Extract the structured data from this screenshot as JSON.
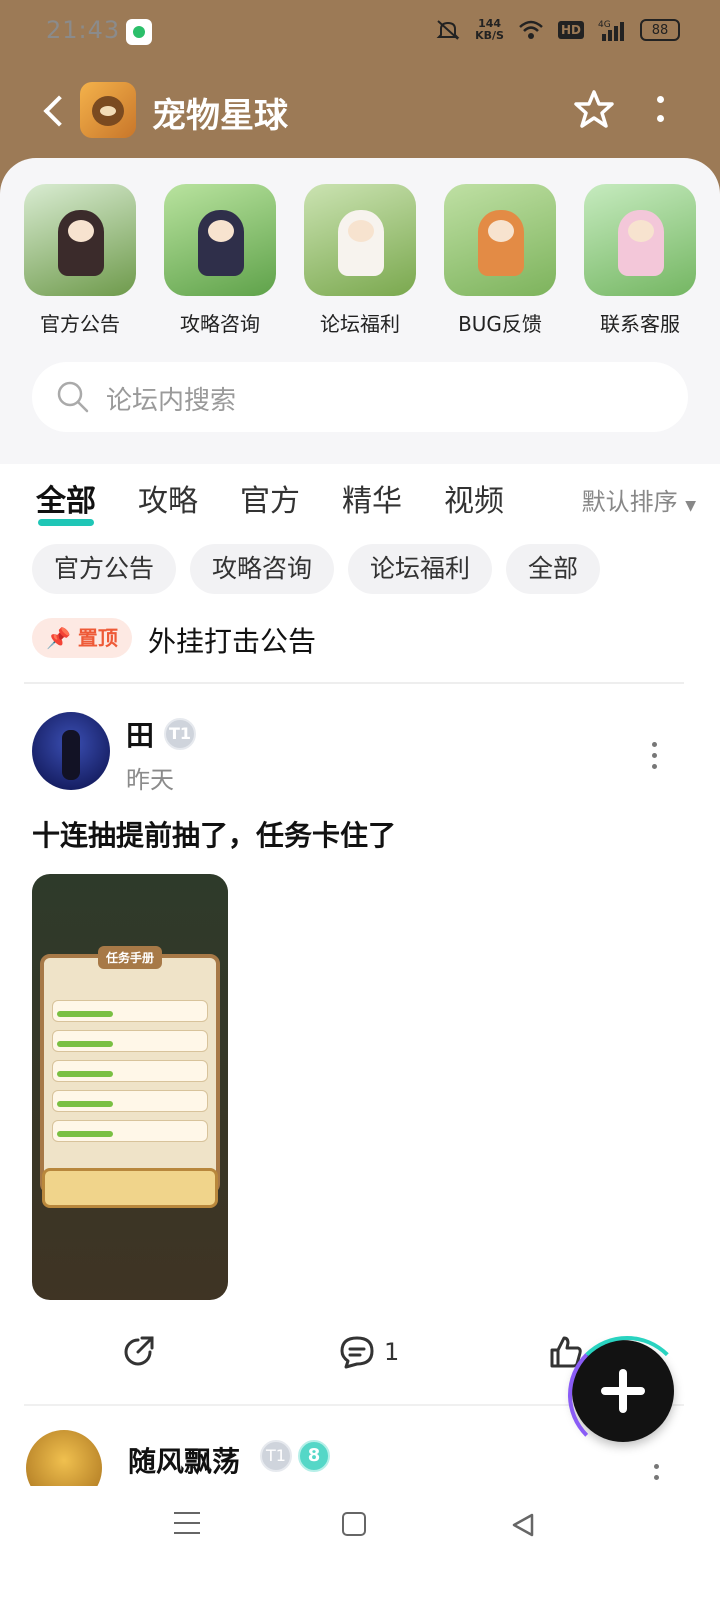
{
  "status_bar": {
    "time": "21:43",
    "speed_top": "144",
    "speed_bottom": "KB/S",
    "hd": "HD",
    "signal": "4G",
    "battery": "88"
  },
  "header": {
    "title": "宠物星球"
  },
  "categories": [
    {
      "label": "官方公告"
    },
    {
      "label": "攻略咨询"
    },
    {
      "label": "论坛福利"
    },
    {
      "label": "BUG反馈"
    },
    {
      "label": "联系客服"
    }
  ],
  "search": {
    "placeholder": "论坛内搜索"
  },
  "tabs": [
    "全部",
    "攻略",
    "官方",
    "精华",
    "视频"
  ],
  "sort_label": "默认排序",
  "chips": [
    "官方公告",
    "攻略咨询",
    "论坛福利",
    "全部"
  ],
  "pinned": {
    "badge": "置顶",
    "title": "外挂打击公告"
  },
  "post": {
    "username": "田",
    "level_badge": "T1",
    "time": "昨天",
    "text": "十连抽提前抽了，任务卡住了",
    "image_title": "任务手册",
    "comment_count": "1"
  },
  "post2": {
    "username": "随风飘荡",
    "level_badge": "T1",
    "badge2": "8"
  },
  "colors": {
    "header_bg": "#9c7a56",
    "accent": "#1fc6b6",
    "pin": "#ee5a37"
  }
}
